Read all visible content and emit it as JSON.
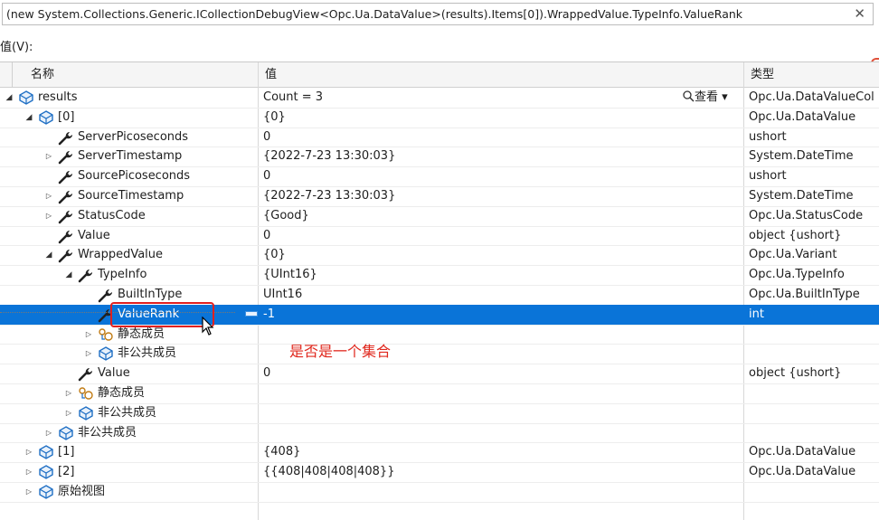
{
  "expression_bar": {
    "text": "(new System.Collections.Generic.ICollectionDebugView<Opc.Ua.DataValue>(results).Items[0]).WrappedValue.TypeInfo.ValueRank",
    "close_glyph": "✕"
  },
  "value_label": "值(V):",
  "columns": {
    "name": "名称",
    "value": "值",
    "type": "类型"
  },
  "view_button": {
    "icon": "search-icon",
    "label": "查看",
    "chevron": "▾"
  },
  "rows": [
    {
      "name": "results",
      "value": "Count = 3",
      "type": "Opc.Ua.DataValueCol"
    },
    {
      "name": "[0]",
      "value": "{0}",
      "type": "Opc.Ua.DataValue"
    },
    {
      "name": "ServerPicoseconds",
      "value": "0",
      "type": "ushort"
    },
    {
      "name": "ServerTimestamp",
      "value": "{2022-7-23 13:30:03}",
      "type": "System.DateTime"
    },
    {
      "name": "SourcePicoseconds",
      "value": "0",
      "type": "ushort"
    },
    {
      "name": "SourceTimestamp",
      "value": "{2022-7-23 13:30:03}",
      "type": "System.DateTime"
    },
    {
      "name": "StatusCode",
      "value": "{Good}",
      "type": "Opc.Ua.StatusCode"
    },
    {
      "name": "Value",
      "value": "0",
      "type": "object {ushort}"
    },
    {
      "name": "WrappedValue",
      "value": "{0}",
      "type": "Opc.Ua.Variant"
    },
    {
      "name": "TypeInfo",
      "value": "{UInt16}",
      "type": "Opc.Ua.TypeInfo"
    },
    {
      "name": "BuiltInType",
      "value": "UInt16",
      "type": "Opc.Ua.BuiltInType"
    },
    {
      "name": "ValueRank",
      "value": "-1",
      "type": "int"
    },
    {
      "name": "静态成员",
      "value": "",
      "type": ""
    },
    {
      "name": "非公共成员",
      "value": "",
      "type": ""
    },
    {
      "name": "Value",
      "value": "0",
      "type": "object {ushort}"
    },
    {
      "name": "静态成员",
      "value": "",
      "type": ""
    },
    {
      "name": "非公共成员",
      "value": "",
      "type": ""
    },
    {
      "name": "非公共成员",
      "value": "",
      "type": ""
    },
    {
      "name": "[1]",
      "value": "{408}",
      "type": "Opc.Ua.DataValue"
    },
    {
      "name": "[2]",
      "value": "{{408|408|408|408}}",
      "type": "Opc.Ua.DataValue"
    },
    {
      "name": "原始视图",
      "value": "",
      "type": ""
    }
  ],
  "annotation": "是否是一个集合",
  "colors": {
    "selection": "#0a74d8",
    "annotation": "#e0281e",
    "highlight_box": "#e02020"
  }
}
